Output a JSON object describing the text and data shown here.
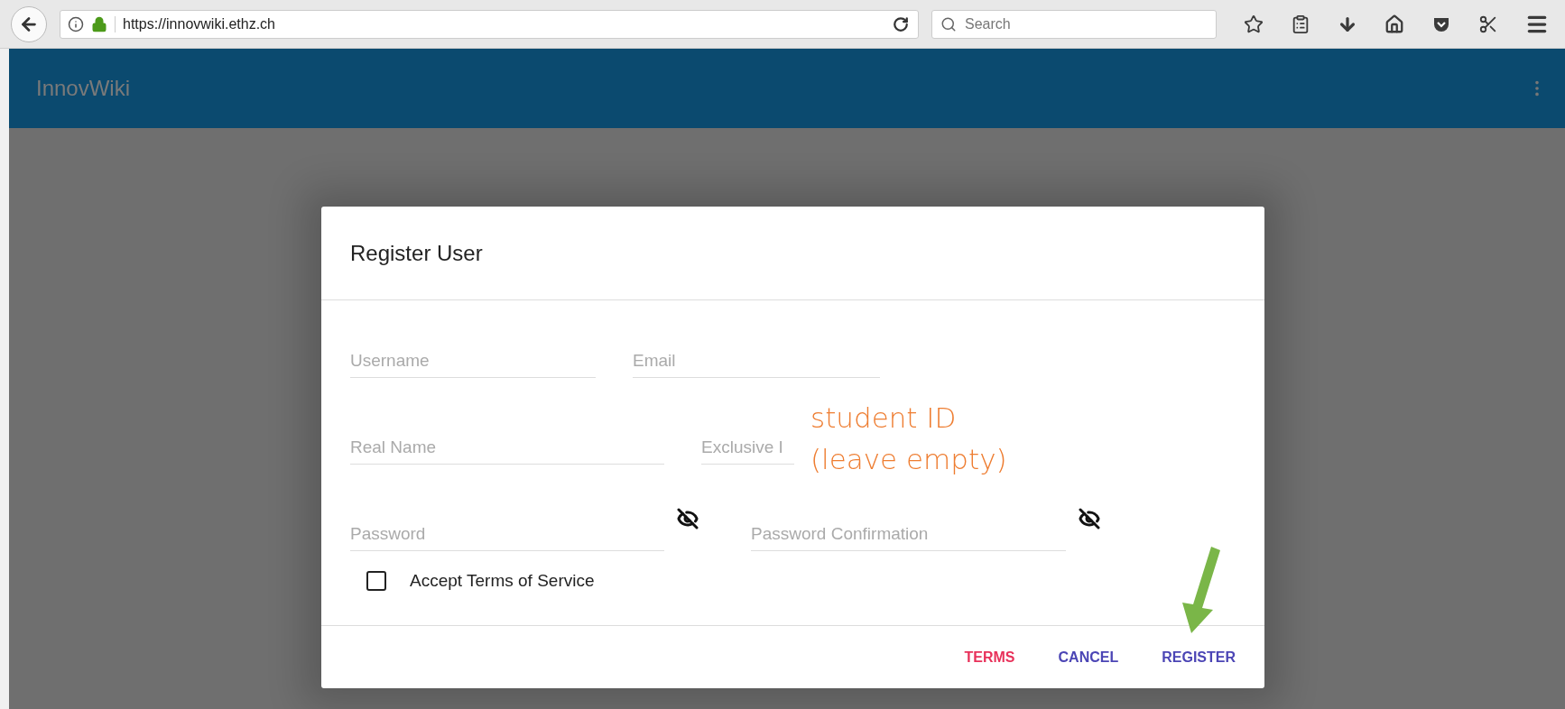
{
  "browser": {
    "url": "https://innovwiki.ethz.ch",
    "search": {
      "placeholder": "Search"
    }
  },
  "app_bar": {
    "title": "InnovWiki"
  },
  "dialog": {
    "title": "Register User",
    "fields": [
      {
        "placeholder": "Username",
        "kind": "text"
      },
      {
        "placeholder": "Email",
        "kind": "text"
      },
      {
        "placeholder": "Real Name",
        "kind": "text"
      },
      {
        "placeholder": "Exclusive I",
        "kind": "text"
      },
      {
        "placeholder": "Password",
        "kind": "password"
      },
      {
        "placeholder": "Password Confirmation",
        "kind": "password"
      }
    ],
    "checkbox": {
      "label": "Accept Terms of Service",
      "checked": false
    },
    "buttons": [
      {
        "label": "TERMS",
        "kind": "danger"
      },
      {
        "label": "CANCEL",
        "kind": "primary"
      },
      {
        "label": "REGISTER",
        "kind": "primary"
      }
    ]
  },
  "annotation": {
    "lines": [
      "student ID",
      "(leave empty)"
    ]
  }
}
